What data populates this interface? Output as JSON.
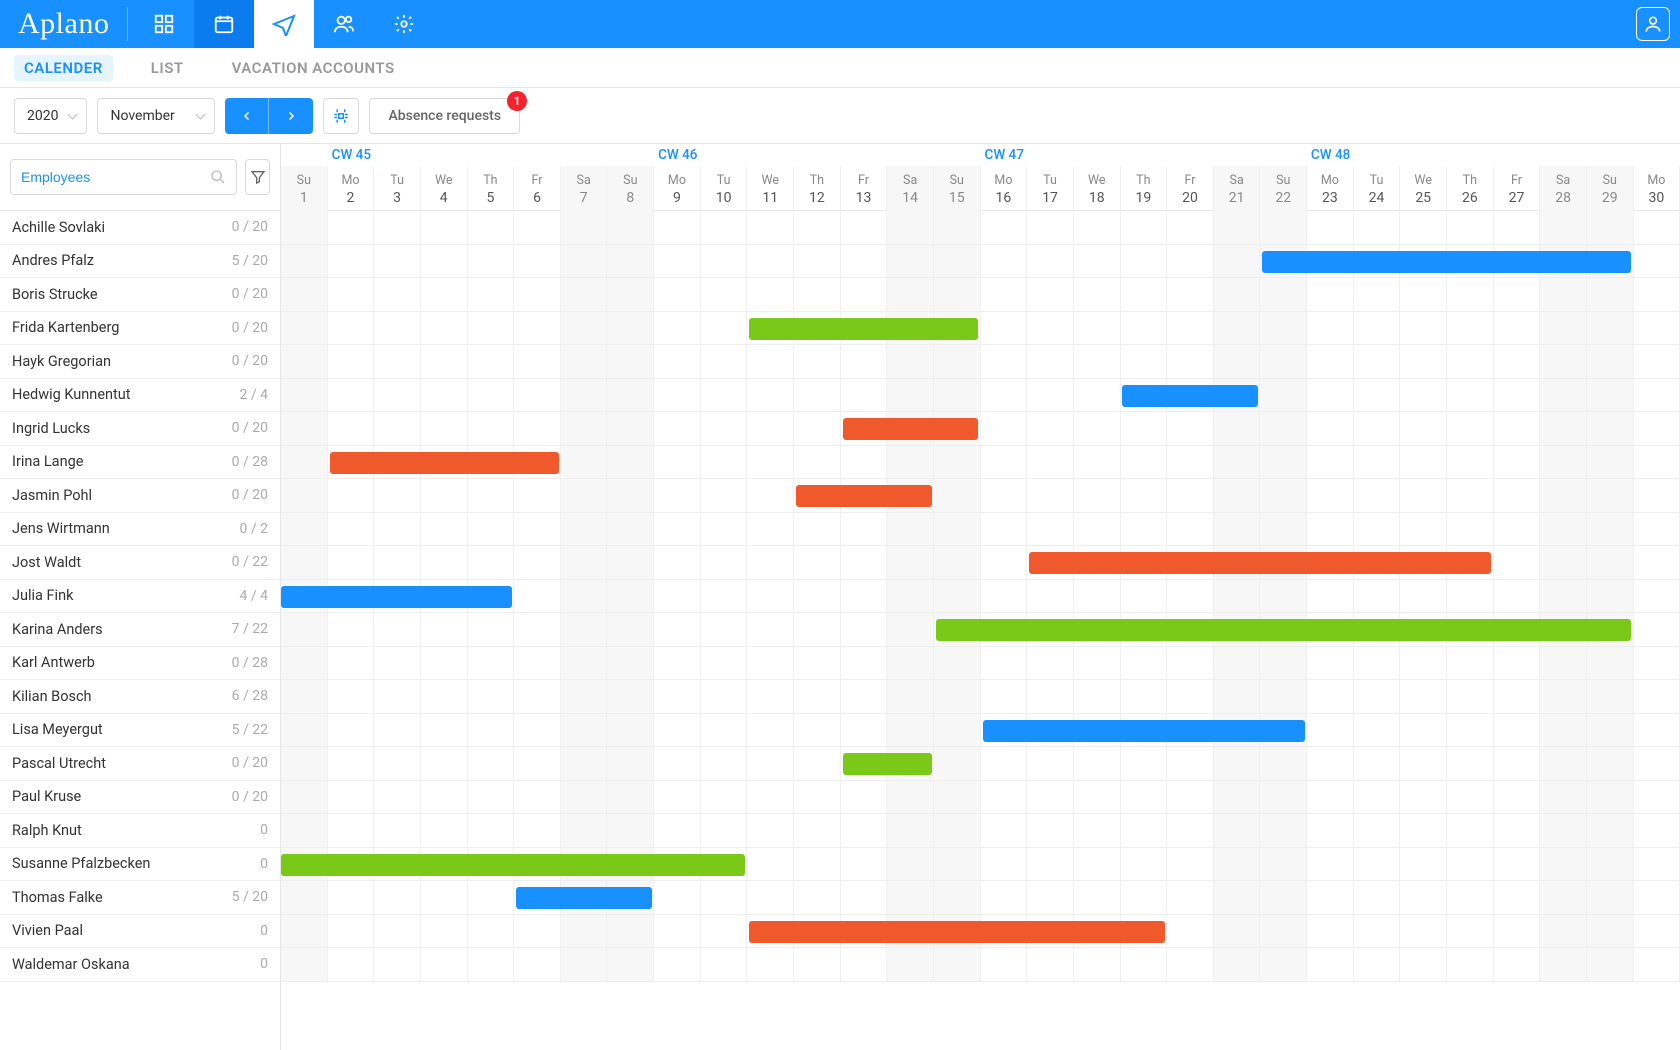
{
  "app": {
    "name": "Aplano"
  },
  "topnav": [
    {
      "id": "dashboard",
      "icon": "grid",
      "state": "normal"
    },
    {
      "id": "calendar",
      "icon": "calendar",
      "state": "dark"
    },
    {
      "id": "absence",
      "icon": "plane",
      "state": "active"
    },
    {
      "id": "users",
      "icon": "users",
      "state": "normal"
    },
    {
      "id": "settings",
      "icon": "gear",
      "state": "normal"
    }
  ],
  "subtabs": [
    {
      "label": "CALENDER",
      "active": true
    },
    {
      "label": "LIST"
    },
    {
      "label": "VACATION ACCOUNTS"
    }
  ],
  "toolbar": {
    "year": "2020",
    "month": "November",
    "absence_label": "Absence requests",
    "absence_badge": "1"
  },
  "search": {
    "placeholder": "Employees"
  },
  "weeks": [
    {
      "label": "CW 45",
      "startDay": 2
    },
    {
      "label": "CW 46",
      "startDay": 9
    },
    {
      "label": "CW 47",
      "startDay": 16
    },
    {
      "label": "CW 48",
      "startDay": 23
    }
  ],
  "days": [
    {
      "dow": "Su",
      "num": 1,
      "weekend": true
    },
    {
      "dow": "Mo",
      "num": 2
    },
    {
      "dow": "Tu",
      "num": 3
    },
    {
      "dow": "We",
      "num": 4
    },
    {
      "dow": "Th",
      "num": 5
    },
    {
      "dow": "Fr",
      "num": 6
    },
    {
      "dow": "Sa",
      "num": 7,
      "weekend": true
    },
    {
      "dow": "Su",
      "num": 8,
      "weekend": true
    },
    {
      "dow": "Mo",
      "num": 9
    },
    {
      "dow": "Tu",
      "num": 10
    },
    {
      "dow": "We",
      "num": 11
    },
    {
      "dow": "Th",
      "num": 12
    },
    {
      "dow": "Fr",
      "num": 13
    },
    {
      "dow": "Sa",
      "num": 14,
      "weekend": true
    },
    {
      "dow": "Su",
      "num": 15,
      "weekend": true
    },
    {
      "dow": "Mo",
      "num": 16
    },
    {
      "dow": "Tu",
      "num": 17
    },
    {
      "dow": "We",
      "num": 18
    },
    {
      "dow": "Th",
      "num": 19
    },
    {
      "dow": "Fr",
      "num": 20
    },
    {
      "dow": "Sa",
      "num": 21,
      "weekend": true
    },
    {
      "dow": "Su",
      "num": 22,
      "weekend": true
    },
    {
      "dow": "Mo",
      "num": 23
    },
    {
      "dow": "Tu",
      "num": 24
    },
    {
      "dow": "We",
      "num": 25
    },
    {
      "dow": "Th",
      "num": 26
    },
    {
      "dow": "Fr",
      "num": 27
    },
    {
      "dow": "Sa",
      "num": 28,
      "weekend": true
    },
    {
      "dow": "Su",
      "num": 29,
      "weekend": true
    },
    {
      "dow": "Mo",
      "num": 30
    }
  ],
  "employees": [
    {
      "name": "Achille Sovlaki",
      "count": "0 / 20",
      "bars": []
    },
    {
      "name": "Andres Pfalz",
      "count": "5 / 20",
      "bars": [
        {
          "color": "blue",
          "from": 22,
          "to": 29
        }
      ]
    },
    {
      "name": "Boris Strucke",
      "count": "0 / 20",
      "bars": []
    },
    {
      "name": "Frida Kartenberg",
      "count": "0 / 20",
      "bars": [
        {
          "color": "green",
          "from": 11,
          "to": 15
        }
      ]
    },
    {
      "name": "Hayk Gregorian",
      "count": "0 / 20",
      "bars": []
    },
    {
      "name": "Hedwig Kunnentut",
      "count": "2 / 4",
      "bars": [
        {
          "color": "blue",
          "from": 19,
          "to": 21
        }
      ]
    },
    {
      "name": "Ingrid Lucks",
      "count": "0 / 20",
      "bars": [
        {
          "color": "orange",
          "from": 13,
          "to": 15
        }
      ]
    },
    {
      "name": "Irina Lange",
      "count": "0 / 28",
      "bars": [
        {
          "color": "orange",
          "from": 2,
          "to": 6
        }
      ]
    },
    {
      "name": "Jasmin Pohl",
      "count": "0 / 20",
      "bars": [
        {
          "color": "orange",
          "from": 12,
          "to": 14
        }
      ]
    },
    {
      "name": "Jens Wirtmann",
      "count": "0 / 2",
      "bars": []
    },
    {
      "name": "Jost Waldt",
      "count": "0 / 22",
      "bars": [
        {
          "color": "orange",
          "from": 17,
          "to": 26
        }
      ]
    },
    {
      "name": "Julia Fink",
      "count": "4 / 4",
      "bars": [
        {
          "color": "blue",
          "from": 1,
          "to": 5,
          "flushLeft": true
        }
      ]
    },
    {
      "name": "Karina Anders",
      "count": "7 / 22",
      "bars": [
        {
          "color": "green",
          "from": 15,
          "to": 29
        }
      ]
    },
    {
      "name": "Karl Antwerb",
      "count": "0 / 28",
      "bars": []
    },
    {
      "name": "Kilian Bosch",
      "count": "6 / 28",
      "bars": []
    },
    {
      "name": "Lisa Meyergut",
      "count": "5 / 22",
      "bars": [
        {
          "color": "blue",
          "from": 16,
          "to": 22
        }
      ]
    },
    {
      "name": "Pascal Utrecht",
      "count": "0 / 20",
      "bars": [
        {
          "color": "green",
          "from": 13,
          "to": 14
        }
      ]
    },
    {
      "name": "Paul Kruse",
      "count": "0 / 20",
      "bars": []
    },
    {
      "name": "Ralph Knut",
      "count": "0",
      "bars": []
    },
    {
      "name": "Susanne Pfalzbecken",
      "count": "0",
      "bars": [
        {
          "color": "green",
          "from": 1,
          "to": 10,
          "flushLeft": true
        }
      ]
    },
    {
      "name": "Thomas Falke",
      "count": "5 / 20",
      "bars": [
        {
          "color": "blue",
          "from": 6,
          "to": 8
        }
      ]
    },
    {
      "name": "Vivien Paal",
      "count": "0",
      "bars": [
        {
          "color": "orange",
          "from": 11,
          "to": 19
        }
      ]
    },
    {
      "name": "Waldemar Oskana",
      "count": "0",
      "bars": []
    }
  ],
  "colors": {
    "brand": "#1890ff",
    "green": "#7ac919",
    "orange": "#f0592b",
    "badge": "#f5222d"
  }
}
